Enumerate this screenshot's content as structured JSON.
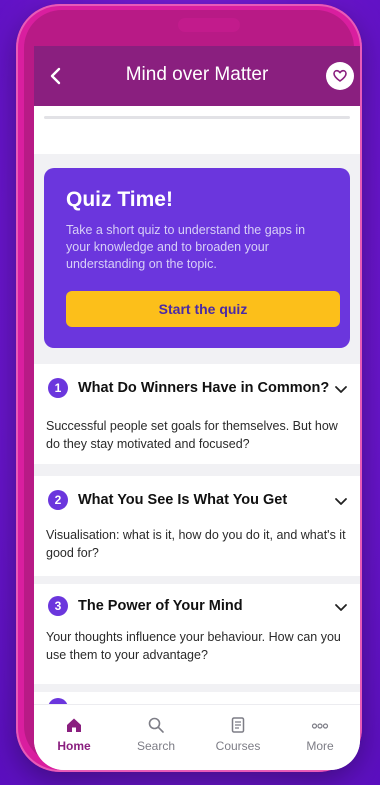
{
  "header": {
    "title": "Mind over Matter",
    "back_icon": "chevron-left-icon",
    "favorite_icon": "heart-icon"
  },
  "quiz": {
    "title": "Quiz Time!",
    "description": "Take a short quiz to understand the gaps in your knowledge and to broaden your understanding on the topic.",
    "button_label": "Start the quiz"
  },
  "lessons": [
    {
      "number": "1",
      "title": "What Do Winners Have in Common?",
      "description": "Successful people set goals for themselves. But how do they stay motivated and focused?"
    },
    {
      "number": "2",
      "title": "What You See Is What You Get",
      "description": "Visualisation: what is it, how do you do it, and what's it good for?"
    },
    {
      "number": "3",
      "title": "The Power of Your Mind",
      "description": "Your thoughts influence your behaviour. How can you use them to your advantage?"
    }
  ],
  "tabs": [
    {
      "label": "Home",
      "icon": "home-icon",
      "active": true
    },
    {
      "label": "Search",
      "icon": "search-icon",
      "active": false
    },
    {
      "label": "Courses",
      "icon": "book-icon",
      "active": false
    },
    {
      "label": "More",
      "icon": "more-dots-icon",
      "active": false
    }
  ],
  "colors": {
    "background": "#7a1fd6",
    "phone_frame": "#d91e9f",
    "header": "#8a1f7f",
    "quiz_card": "#6b36dd",
    "quiz_button": "#fcbf1a",
    "active_tab": "#8a1f7f"
  }
}
